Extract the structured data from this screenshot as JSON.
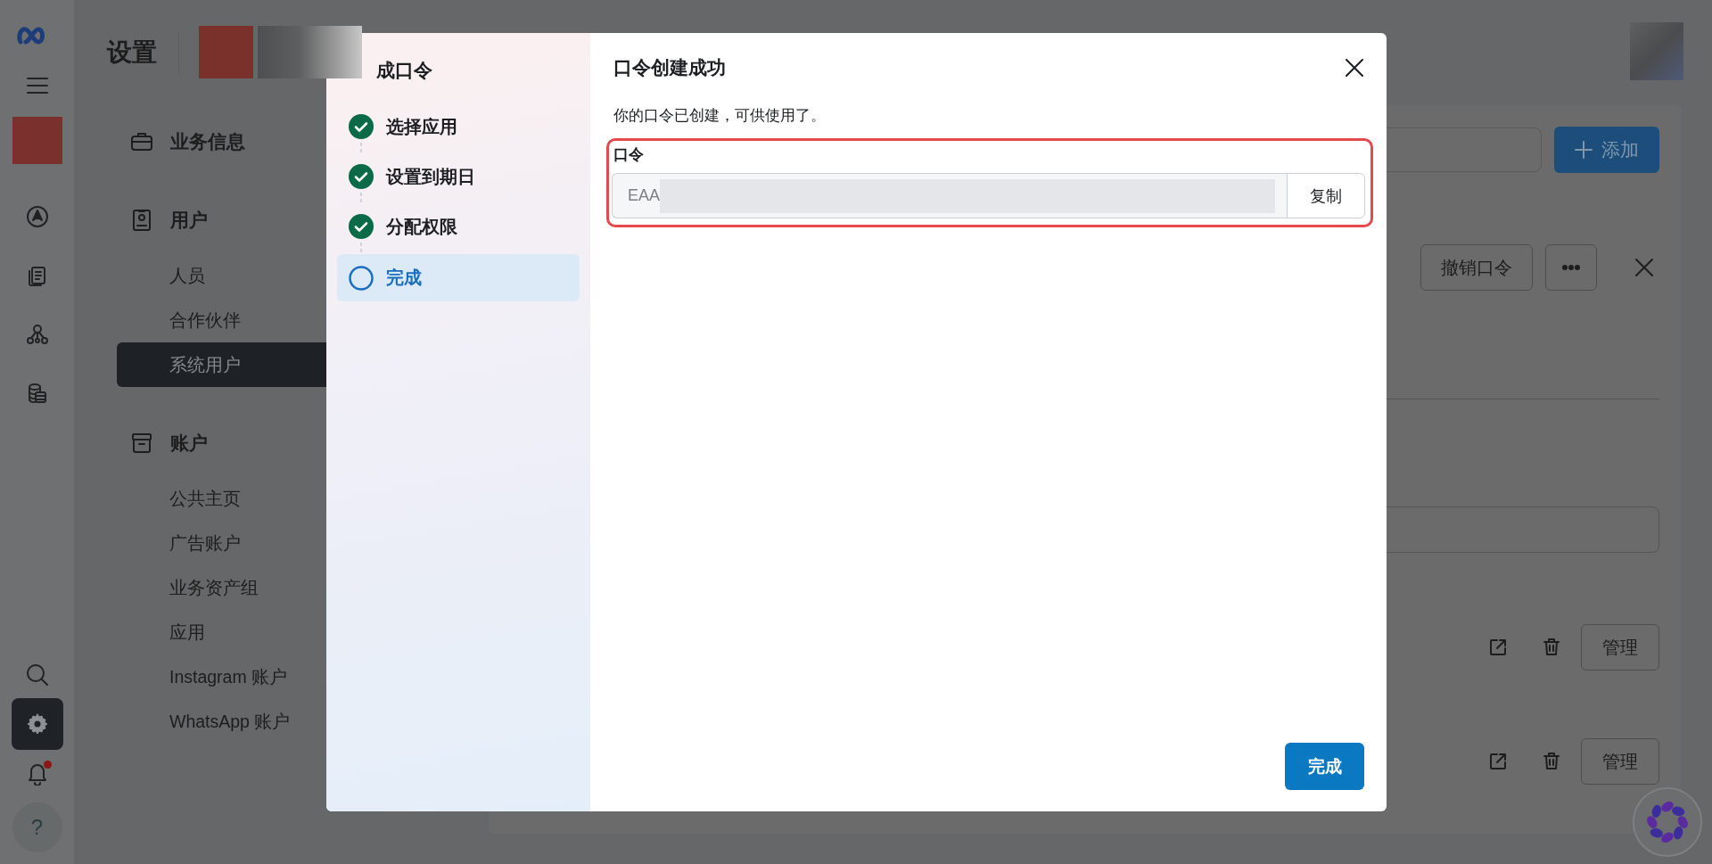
{
  "rail": {
    "items": [
      {
        "selected": false
      },
      {
        "selected": false
      },
      {
        "selected": false
      },
      {
        "selected": false
      },
      {
        "selected": false
      },
      {
        "selected": true
      },
      {
        "selected": false
      }
    ],
    "notification_dot": true,
    "help_label": "?"
  },
  "header": {
    "title": "设置"
  },
  "nav": {
    "sections": [
      {
        "label": "业务信息"
      },
      {
        "label": "用户",
        "items": [
          {
            "label": "人员",
            "selected": false
          },
          {
            "label": "合作伙伴",
            "selected": false
          },
          {
            "label": "系统用户",
            "selected": true
          }
        ]
      },
      {
        "label": "账户",
        "items": [
          {
            "label": "公共主页",
            "selected": false
          },
          {
            "label": "广告账户",
            "selected": false
          },
          {
            "label": "业务资产组",
            "selected": false
          },
          {
            "label": "应用",
            "selected": false
          },
          {
            "label": "Instagram 账户",
            "selected": false
          },
          {
            "label": "WhatsApp 账户",
            "selected": false
          }
        ]
      }
    ]
  },
  "content": {
    "add_button": "添加",
    "revoke_button": "撤销口令",
    "asset_rows": [
      {
        "manage_button": "管理"
      },
      {
        "manage_button": "管理"
      }
    ]
  },
  "dialog": {
    "flow_title": "成口令",
    "steps": [
      {
        "label": "选择应用",
        "done": true,
        "selected": false
      },
      {
        "label": "设置到期日",
        "done": true,
        "selected": false
      },
      {
        "label": "分配权限",
        "done": true,
        "selected": false
      },
      {
        "label": "完成",
        "done": false,
        "selected": true
      }
    ],
    "title": "口令创建成功",
    "message": "你的口令已创建，可供使用了。",
    "field_label": "口令",
    "token_value": "EAA",
    "copy_button": "复制",
    "done_button": "完成"
  }
}
